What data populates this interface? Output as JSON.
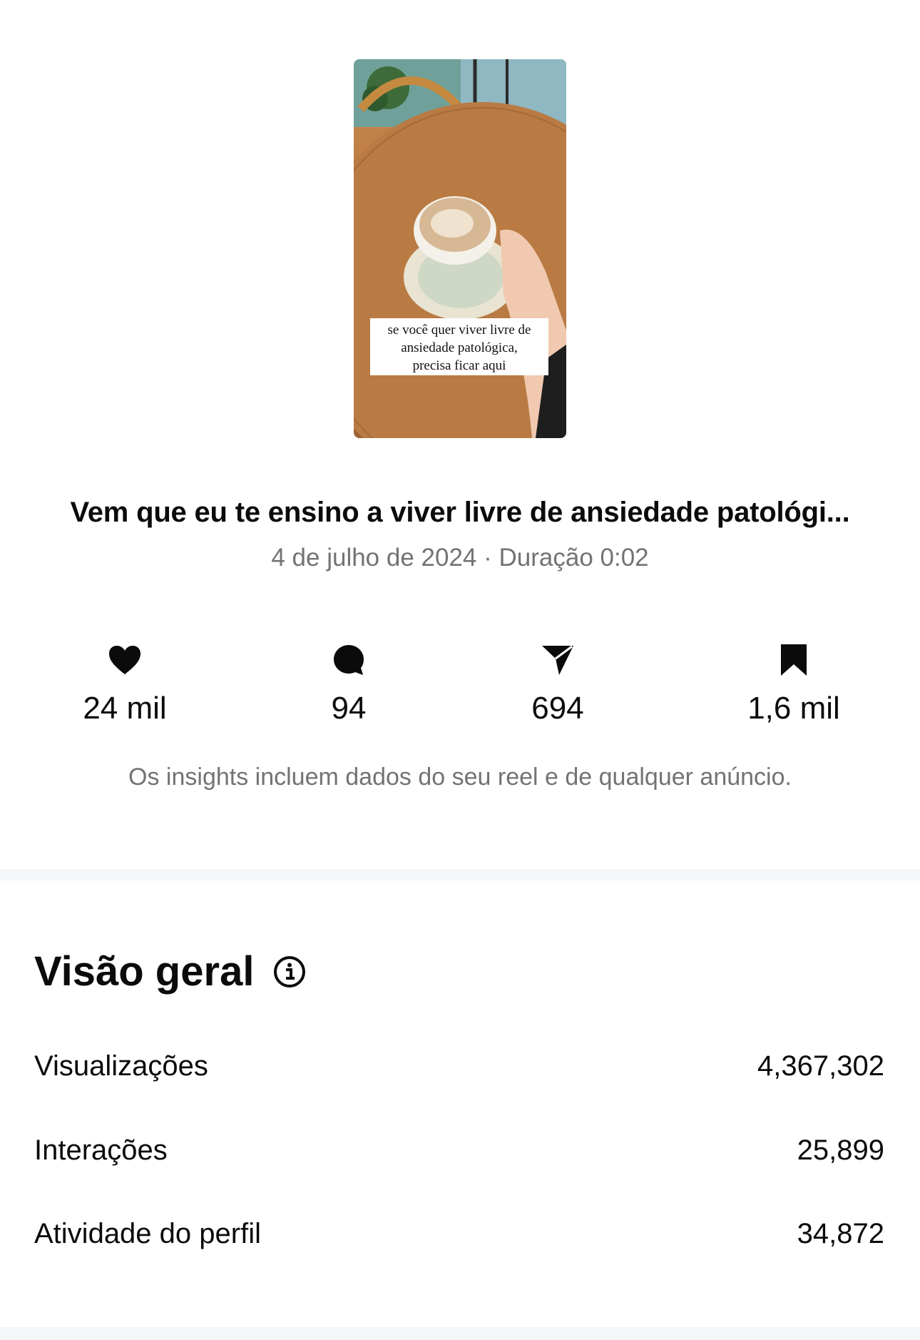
{
  "thumbnail": {
    "caption_lines": [
      "se você quer viver livre de",
      "ansiedade patológica,",
      "precisa ficar aqui"
    ]
  },
  "reel": {
    "title": "Vem que eu te ensino a viver livre de ansiedade patológi...",
    "meta": "4 de julho de 2024 · Duração 0:02"
  },
  "metrics": [
    {
      "icon": "heart-icon",
      "value": "24 mil"
    },
    {
      "icon": "comment-icon",
      "value": "94"
    },
    {
      "icon": "send-icon",
      "value": "694"
    },
    {
      "icon": "bookmark-icon",
      "value": "1,6 mil"
    }
  ],
  "note": "Os insights incluem dados do seu reel e de qualquer anúncio.",
  "overview": {
    "title": "Visão geral",
    "rows": [
      {
        "label": "Visualizações",
        "value": "4,367,302"
      },
      {
        "label": "Interações",
        "value": "25,899"
      },
      {
        "label": "Atividade do perfil",
        "value": "34,872"
      }
    ]
  },
  "colors": {
    "text": "#0b0b0b",
    "secondary_text": "#737373",
    "divider": "#f5f6f7"
  }
}
